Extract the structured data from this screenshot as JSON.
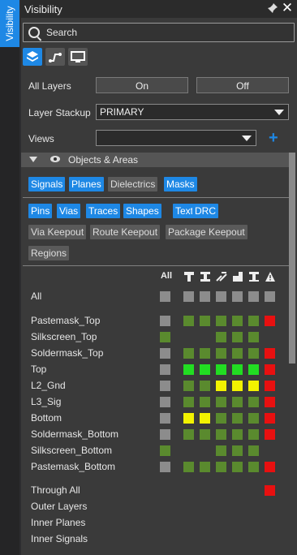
{
  "side_tab": {
    "label": "Visibility"
  },
  "window": {
    "title": "Visibility"
  },
  "search": {
    "placeholder": "Search"
  },
  "mode_icons": [
    "layers-icon",
    "routing-icon",
    "monitor-icon"
  ],
  "all_layers": {
    "label": "All Layers",
    "on": "On",
    "off": "Off"
  },
  "layer_stackup": {
    "label": "Layer Stackup",
    "value": "PRIMARY"
  },
  "views": {
    "label": "Views",
    "value": ""
  },
  "section": {
    "title": "Objects & Areas"
  },
  "object_chips_row1": [
    {
      "label": "Signals",
      "active": true
    },
    {
      "label": "Planes",
      "active": true
    },
    {
      "label": "Dielectrics",
      "active": false
    },
    {
      "label": "Masks",
      "active": true
    }
  ],
  "object_chips_row2": [
    {
      "label": "Pins",
      "active": true
    },
    {
      "label": "Vias",
      "active": true
    },
    {
      "label": "Traces",
      "active": true
    },
    {
      "label": "Shapes",
      "active": true
    },
    {
      "label": "Text",
      "active": true
    },
    {
      "label": "DRC",
      "active": true
    }
  ],
  "object_chips_row3": [
    {
      "label": "Via Keepout",
      "active": false
    },
    {
      "label": "Route Keepout",
      "active": false
    },
    {
      "label": "Package Keepout",
      "active": false
    }
  ],
  "object_chips_row4": [
    {
      "label": "Regions",
      "active": false
    }
  ],
  "grid": {
    "all_header": "All",
    "column_icons": [
      "pin-icon",
      "via-icon",
      "trace-icon",
      "shape-icon",
      "text-icon",
      "drc-icon"
    ],
    "colors": {
      "gray": "#8c8c8c",
      "green": "#5a8a2e",
      "bright_green": "#22dd22",
      "yellow": "#f2f200",
      "red": "#e81010"
    },
    "all_row": {
      "label": "All",
      "cells": [
        "gray",
        "gray",
        "gray",
        "gray",
        "gray",
        "gray",
        "gray"
      ]
    },
    "rows": [
      {
        "label": "Pastemask_Top",
        "cells": [
          "gray",
          "green",
          "green",
          "green",
          "green",
          "green",
          "red"
        ]
      },
      {
        "label": "Silkscreen_Top",
        "cells": [
          "green",
          "",
          "",
          "green",
          "green",
          "green",
          ""
        ]
      },
      {
        "label": "Soldermask_Top",
        "cells": [
          "gray",
          "green",
          "green",
          "green",
          "green",
          "green",
          "red"
        ]
      },
      {
        "label": "Top",
        "cells": [
          "gray",
          "bright_green",
          "bright_green",
          "bright_green",
          "bright_green",
          "bright_green",
          "red"
        ]
      },
      {
        "label": "L2_Gnd",
        "cells": [
          "gray",
          "green",
          "green",
          "yellow",
          "yellow",
          "yellow",
          "red"
        ]
      },
      {
        "label": "L3_Sig",
        "cells": [
          "gray",
          "green",
          "green",
          "green",
          "green",
          "green",
          "red"
        ]
      },
      {
        "label": "Bottom",
        "cells": [
          "gray",
          "yellow",
          "yellow",
          "green",
          "green",
          "green",
          "red"
        ]
      },
      {
        "label": "Soldermask_Bottom",
        "cells": [
          "gray",
          "green",
          "green",
          "green",
          "green",
          "green",
          "red"
        ]
      },
      {
        "label": "Silkscreen_Bottom",
        "cells": [
          "green",
          "",
          "",
          "green",
          "green",
          "green",
          ""
        ]
      },
      {
        "label": "Pastemask_Bottom",
        "cells": [
          "gray",
          "green",
          "green",
          "green",
          "green",
          "green",
          "red"
        ]
      }
    ],
    "extra_rows": [
      {
        "label": "Through All",
        "cells": [
          "",
          "",
          "",
          "",
          "",
          "",
          "red"
        ]
      },
      {
        "label": "Outer Layers",
        "cells": [
          "",
          "",
          "",
          "",
          "",
          "",
          ""
        ]
      },
      {
        "label": "Inner Planes",
        "cells": [
          "",
          "",
          "",
          "",
          "",
          "",
          ""
        ]
      },
      {
        "label": "Inner Signals",
        "cells": [
          "",
          "",
          "",
          "",
          "",
          "",
          ""
        ]
      }
    ]
  }
}
